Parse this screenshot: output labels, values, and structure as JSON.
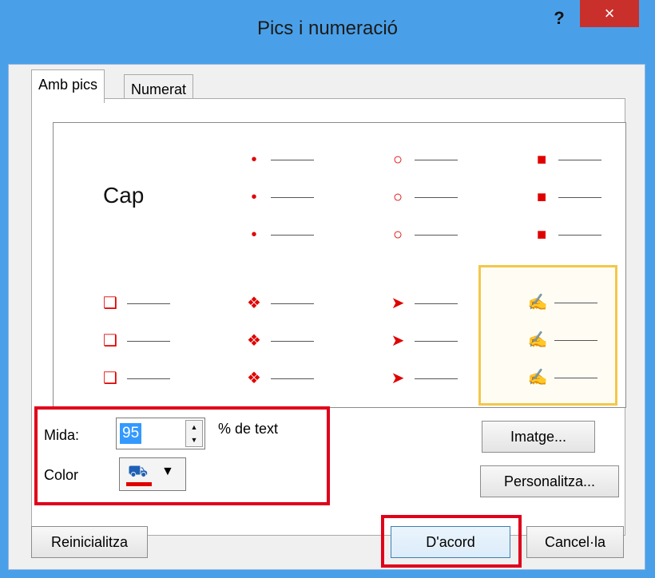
{
  "dialog": {
    "title": "Pics i numeració",
    "help_label": "?",
    "close_label": "×"
  },
  "tabs": [
    {
      "label": "Amb pics",
      "active": true
    },
    {
      "label": "Numerat",
      "active": false
    }
  ],
  "gallery": {
    "none_label": "Cap",
    "bullet_color": "#e00000",
    "selection_color": "#f3c74a",
    "styles": [
      {
        "name": "none"
      },
      {
        "name": "filled-round",
        "glyph": "•"
      },
      {
        "name": "hollow-round",
        "glyph": "○"
      },
      {
        "name": "filled-square",
        "glyph": "■"
      },
      {
        "name": "hollow-square",
        "glyph": "❑"
      },
      {
        "name": "star-diamond",
        "glyph": "❖"
      },
      {
        "name": "arrowhead",
        "glyph": "➤"
      },
      {
        "name": "check-hand",
        "glyph": "✍",
        "selected": true
      }
    ]
  },
  "size": {
    "label": "Mida:",
    "value": "95",
    "unit_label": "% de text"
  },
  "color": {
    "label": "Color",
    "current": "#e00000"
  },
  "buttons": {
    "image": "Imatge...",
    "customize": "Personalitza...",
    "reset": "Reinicialitza",
    "ok": "D'acord",
    "cancel": "Cancel·la"
  },
  "highlight_color": "#e0001a"
}
